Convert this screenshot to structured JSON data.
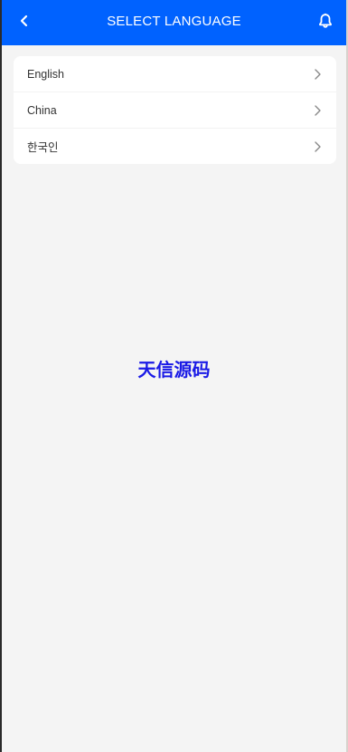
{
  "header": {
    "title": "SELECT LANGUAGE",
    "back_icon": "chevron-left-icon",
    "bell_icon": "bell-icon",
    "background": "#0062ff"
  },
  "languages": [
    {
      "label": "English"
    },
    {
      "label": "China"
    },
    {
      "label": "한국인"
    }
  ],
  "watermark": {
    "text": "天信源码",
    "color": "#1a1ae6"
  }
}
